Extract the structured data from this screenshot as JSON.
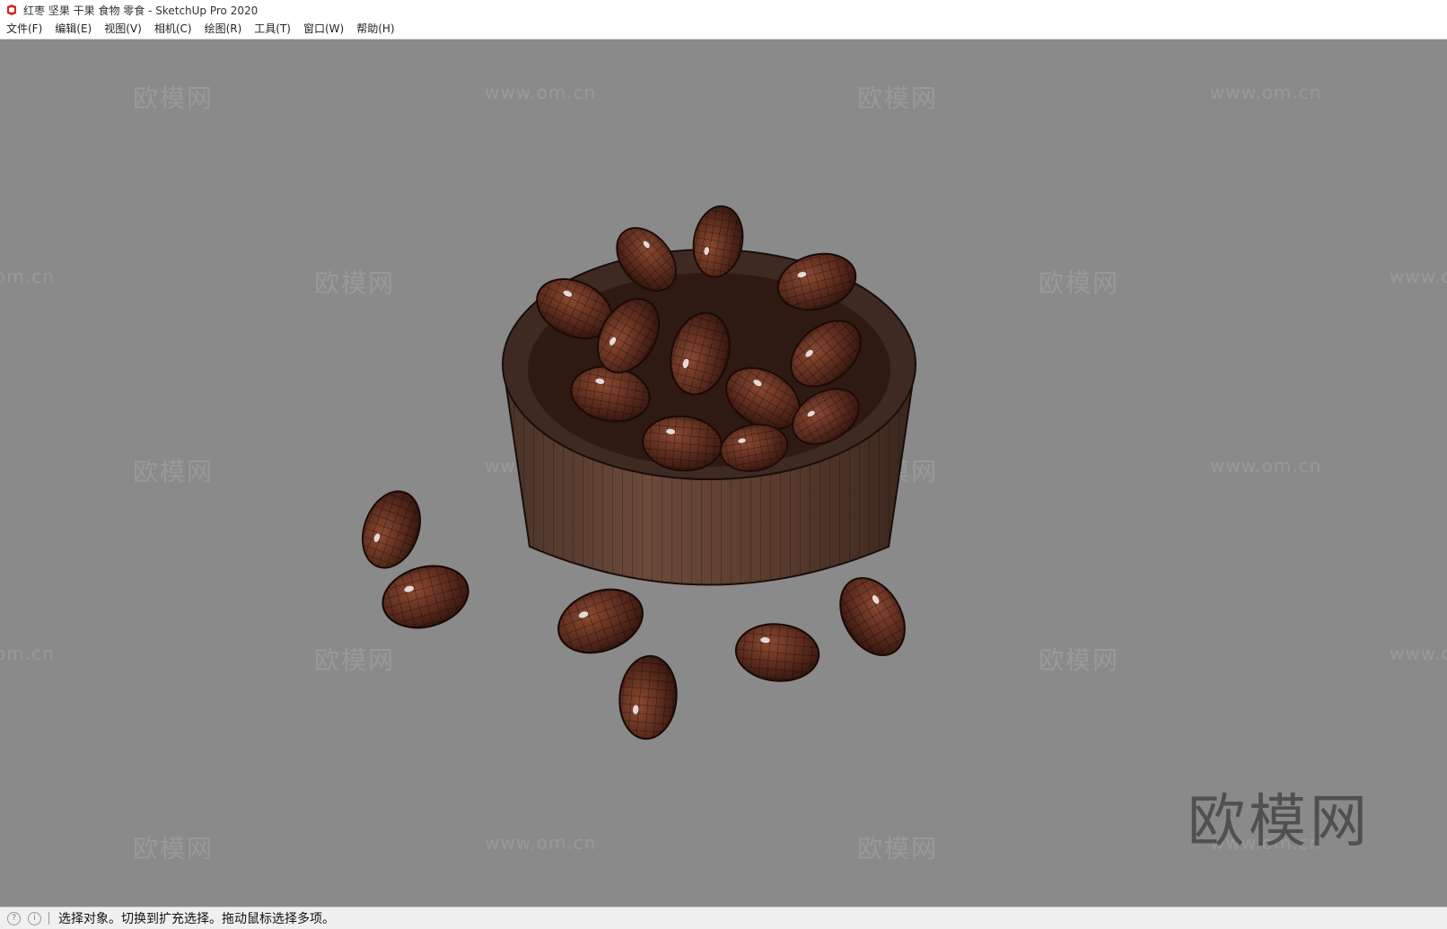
{
  "window": {
    "title": "红枣 坚果 干果 食物 零食 - SketchUp Pro 2020",
    "app_icon": "sketchup-icon"
  },
  "menu": [
    "文件(F)",
    "编辑(E)",
    "视图(V)",
    "相机(C)",
    "绘图(R)",
    "工具(T)",
    "窗口(W)",
    "帮助(H)"
  ],
  "viewport": {
    "background": "#8a8a8a",
    "scene": "wooden bowl of red dates",
    "watermark_cn": "欧模网",
    "watermark_url": "www.om.cn",
    "watermark_url_partial": "om.cn",
    "watermark_url_cut": "www.o",
    "watermark_big": "欧模网"
  },
  "status": {
    "icons": [
      "geo-location-icon",
      "info-icon"
    ],
    "text": "选择对象。切换到扩充选择。拖动鼠标选择多项。"
  }
}
